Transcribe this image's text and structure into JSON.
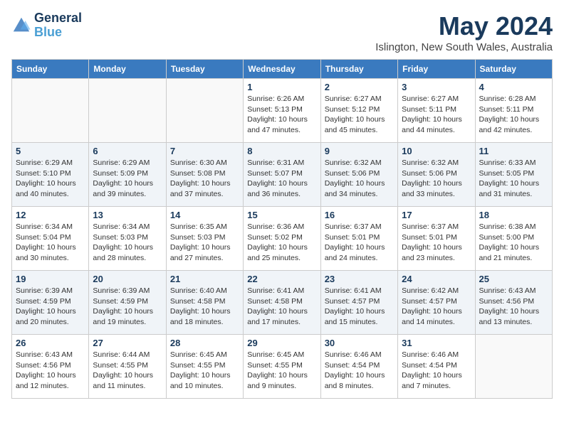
{
  "header": {
    "logo_line1": "General",
    "logo_line2": "Blue",
    "month_title": "May 2024",
    "location": "Islington, New South Wales, Australia"
  },
  "weekdays": [
    "Sunday",
    "Monday",
    "Tuesday",
    "Wednesday",
    "Thursday",
    "Friday",
    "Saturday"
  ],
  "weeks": [
    [
      {
        "day": "",
        "info": ""
      },
      {
        "day": "",
        "info": ""
      },
      {
        "day": "",
        "info": ""
      },
      {
        "day": "1",
        "info": "Sunrise: 6:26 AM\nSunset: 5:13 PM\nDaylight: 10 hours and 47 minutes."
      },
      {
        "day": "2",
        "info": "Sunrise: 6:27 AM\nSunset: 5:12 PM\nDaylight: 10 hours and 45 minutes."
      },
      {
        "day": "3",
        "info": "Sunrise: 6:27 AM\nSunset: 5:11 PM\nDaylight: 10 hours and 44 minutes."
      },
      {
        "day": "4",
        "info": "Sunrise: 6:28 AM\nSunset: 5:11 PM\nDaylight: 10 hours and 42 minutes."
      }
    ],
    [
      {
        "day": "5",
        "info": "Sunrise: 6:29 AM\nSunset: 5:10 PM\nDaylight: 10 hours and 40 minutes."
      },
      {
        "day": "6",
        "info": "Sunrise: 6:29 AM\nSunset: 5:09 PM\nDaylight: 10 hours and 39 minutes."
      },
      {
        "day": "7",
        "info": "Sunrise: 6:30 AM\nSunset: 5:08 PM\nDaylight: 10 hours and 37 minutes."
      },
      {
        "day": "8",
        "info": "Sunrise: 6:31 AM\nSunset: 5:07 PM\nDaylight: 10 hours and 36 minutes."
      },
      {
        "day": "9",
        "info": "Sunrise: 6:32 AM\nSunset: 5:06 PM\nDaylight: 10 hours and 34 minutes."
      },
      {
        "day": "10",
        "info": "Sunrise: 6:32 AM\nSunset: 5:06 PM\nDaylight: 10 hours and 33 minutes."
      },
      {
        "day": "11",
        "info": "Sunrise: 6:33 AM\nSunset: 5:05 PM\nDaylight: 10 hours and 31 minutes."
      }
    ],
    [
      {
        "day": "12",
        "info": "Sunrise: 6:34 AM\nSunset: 5:04 PM\nDaylight: 10 hours and 30 minutes."
      },
      {
        "day": "13",
        "info": "Sunrise: 6:34 AM\nSunset: 5:03 PM\nDaylight: 10 hours and 28 minutes."
      },
      {
        "day": "14",
        "info": "Sunrise: 6:35 AM\nSunset: 5:03 PM\nDaylight: 10 hours and 27 minutes."
      },
      {
        "day": "15",
        "info": "Sunrise: 6:36 AM\nSunset: 5:02 PM\nDaylight: 10 hours and 25 minutes."
      },
      {
        "day": "16",
        "info": "Sunrise: 6:37 AM\nSunset: 5:01 PM\nDaylight: 10 hours and 24 minutes."
      },
      {
        "day": "17",
        "info": "Sunrise: 6:37 AM\nSunset: 5:01 PM\nDaylight: 10 hours and 23 minutes."
      },
      {
        "day": "18",
        "info": "Sunrise: 6:38 AM\nSunset: 5:00 PM\nDaylight: 10 hours and 21 minutes."
      }
    ],
    [
      {
        "day": "19",
        "info": "Sunrise: 6:39 AM\nSunset: 4:59 PM\nDaylight: 10 hours and 20 minutes."
      },
      {
        "day": "20",
        "info": "Sunrise: 6:39 AM\nSunset: 4:59 PM\nDaylight: 10 hours and 19 minutes."
      },
      {
        "day": "21",
        "info": "Sunrise: 6:40 AM\nSunset: 4:58 PM\nDaylight: 10 hours and 18 minutes."
      },
      {
        "day": "22",
        "info": "Sunrise: 6:41 AM\nSunset: 4:58 PM\nDaylight: 10 hours and 17 minutes."
      },
      {
        "day": "23",
        "info": "Sunrise: 6:41 AM\nSunset: 4:57 PM\nDaylight: 10 hours and 15 minutes."
      },
      {
        "day": "24",
        "info": "Sunrise: 6:42 AM\nSunset: 4:57 PM\nDaylight: 10 hours and 14 minutes."
      },
      {
        "day": "25",
        "info": "Sunrise: 6:43 AM\nSunset: 4:56 PM\nDaylight: 10 hours and 13 minutes."
      }
    ],
    [
      {
        "day": "26",
        "info": "Sunrise: 6:43 AM\nSunset: 4:56 PM\nDaylight: 10 hours and 12 minutes."
      },
      {
        "day": "27",
        "info": "Sunrise: 6:44 AM\nSunset: 4:55 PM\nDaylight: 10 hours and 11 minutes."
      },
      {
        "day": "28",
        "info": "Sunrise: 6:45 AM\nSunset: 4:55 PM\nDaylight: 10 hours and 10 minutes."
      },
      {
        "day": "29",
        "info": "Sunrise: 6:45 AM\nSunset: 4:55 PM\nDaylight: 10 hours and 9 minutes."
      },
      {
        "day": "30",
        "info": "Sunrise: 6:46 AM\nSunset: 4:54 PM\nDaylight: 10 hours and 8 minutes."
      },
      {
        "day": "31",
        "info": "Sunrise: 6:46 AM\nSunset: 4:54 PM\nDaylight: 10 hours and 7 minutes."
      },
      {
        "day": "",
        "info": ""
      }
    ]
  ]
}
